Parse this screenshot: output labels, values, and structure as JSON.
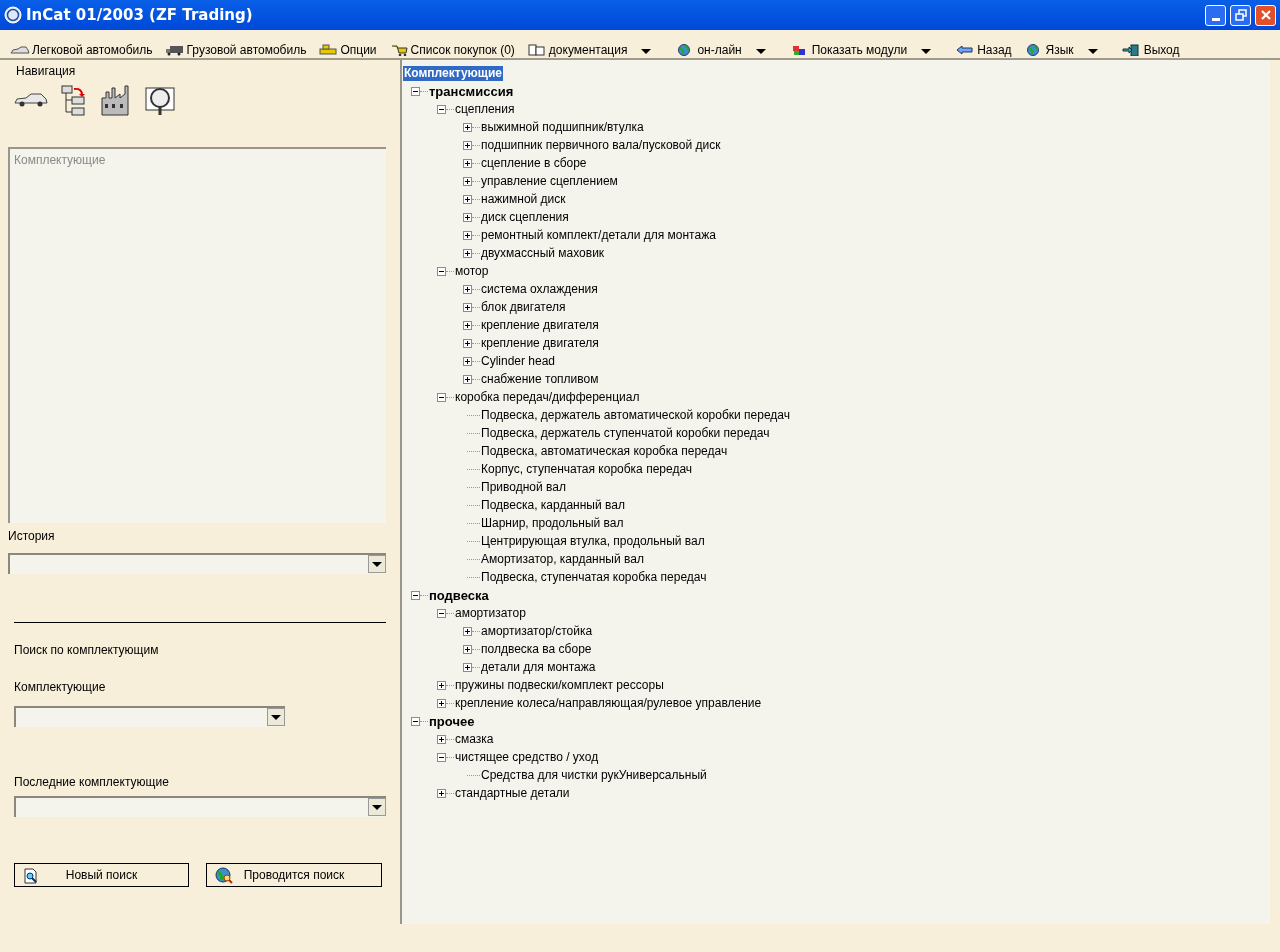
{
  "window": {
    "title": "InCat 01/2003 (ZF Trading)"
  },
  "toolbar": [
    {
      "label": "Легковой автомобиль",
      "dropdown": false
    },
    {
      "label": "Грузовой автомобиль",
      "dropdown": false
    },
    {
      "label": "Опции",
      "dropdown": false
    },
    {
      "label": "Список покупок (0)",
      "dropdown": false
    },
    {
      "label": "документация",
      "dropdown": true
    },
    {
      "label": "он-лайн",
      "dropdown": true
    },
    {
      "label": "Показать модули",
      "dropdown": true
    },
    {
      "label": "Назад",
      "dropdown": false
    },
    {
      "label": "Язык",
      "dropdown": true
    },
    {
      "label": "Выход",
      "dropdown": false
    }
  ],
  "navigation": {
    "title": "Навигация",
    "panel_label": "Комплектующие"
  },
  "history": {
    "label": "История"
  },
  "search": {
    "title": "Поиск по комплектующим",
    "parts_label": "Комплектующие",
    "recent_label": "Последние комплектующие",
    "buttons": [
      {
        "label": "Новый поиск"
      },
      {
        "label": "Проводится поиск"
      }
    ]
  },
  "tree": {
    "root": "Комплектующие",
    "items": [
      {
        "label": "трансмиссия",
        "kind": "folder",
        "expanded": true,
        "children": [
          {
            "label": "сцепления",
            "kind": "folder",
            "expanded": true,
            "children": [
              {
                "label": "выжимной подшипник/втулка",
                "kind": "folder",
                "expanded": false
              },
              {
                "label": "подшипник первичного вала/пусковой диск",
                "kind": "folder",
                "expanded": false
              },
              {
                "label": "сцепление в сборе",
                "kind": "folder",
                "expanded": false
              },
              {
                "label": "управление сцеплением",
                "kind": "folder",
                "expanded": false
              },
              {
                "label": "нажимной диск",
                "kind": "folder",
                "expanded": false
              },
              {
                "label": "диск сцепления",
                "kind": "folder",
                "expanded": false
              },
              {
                "label": "ремонтный комплект/детали для монтажа",
                "kind": "folder",
                "expanded": false
              },
              {
                "label": "двухмассный маховик",
                "kind": "folder",
                "expanded": false
              }
            ]
          },
          {
            "label": "мотор",
            "kind": "folder",
            "expanded": true,
            "children": [
              {
                "label": "система охлаждения",
                "kind": "folder",
                "expanded": false
              },
              {
                "label": "блок двигателя",
                "kind": "folder",
                "expanded": false
              },
              {
                "label": "крепление двигателя",
                "kind": "folder",
                "expanded": false
              },
              {
                "label": "крепление двигателя",
                "kind": "folder",
                "expanded": false
              },
              {
                "label": "Cylinder head",
                "kind": "folder",
                "expanded": false
              },
              {
                "label": "снабжение топливом",
                "kind": "folder",
                "expanded": false
              }
            ]
          },
          {
            "label": "коробка передач/дифференциал",
            "kind": "folder",
            "expanded": true,
            "children": [
              {
                "label": "Подвеска, держатель автоматической коробки передач",
                "kind": "leaf"
              },
              {
                "label": "Подвеска, держатель ступенчатой коробки передач",
                "kind": "leaf"
              },
              {
                "label": "Подвеска, автоматическая коробка передач",
                "kind": "leaf"
              },
              {
                "label": "Корпус, ступенчатая коробка передач",
                "kind": "leaf"
              },
              {
                "label": "Приводной вал",
                "kind": "leaf"
              },
              {
                "label": "Подвеска, карданный вал",
                "kind": "leaf"
              },
              {
                "label": "Шарнир, продольный вал",
                "kind": "leaf"
              },
              {
                "label": "Центрирующая втулка, продольный вал",
                "kind": "leaf"
              },
              {
                "label": "Амортизатор, карданный вал",
                "kind": "leaf"
              },
              {
                "label": "Подвеска, ступенчатая коробка передач",
                "kind": "leaf"
              }
            ]
          }
        ]
      },
      {
        "label": "подвеска",
        "kind": "folder",
        "expanded": true,
        "children": [
          {
            "label": "амортизатор",
            "kind": "folder",
            "expanded": true,
            "children": [
              {
                "label": "амортизатор/стойка",
                "kind": "folder",
                "expanded": false
              },
              {
                "label": "полдвеска ва сборе",
                "kind": "folder",
                "expanded": false
              },
              {
                "label": "детали для монтажа",
                "kind": "folder",
                "expanded": false
              }
            ]
          },
          {
            "label": "пружины подвески/комплект рессоры",
            "kind": "folder",
            "expanded": false
          },
          {
            "label": "крепление колеса/направляющая/рулевое управление",
            "kind": "folder",
            "expanded": false
          }
        ]
      },
      {
        "label": "прочее",
        "kind": "folder",
        "expanded": true,
        "children": [
          {
            "label": "смазка",
            "kind": "folder",
            "expanded": false
          },
          {
            "label": "чистящее средство / уход",
            "kind": "folder",
            "expanded": true,
            "children": [
              {
                "label": "Средства для чистки рукУниверсальный",
                "kind": "leaf"
              }
            ]
          },
          {
            "label": "стандартные детали",
            "kind": "folder",
            "expanded": false
          }
        ]
      }
    ]
  }
}
